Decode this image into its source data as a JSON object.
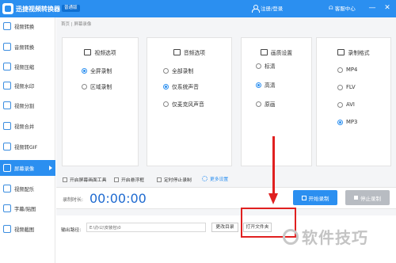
{
  "app": {
    "title": "迅捷视频转换器",
    "badge": "普通版"
  },
  "header": {
    "user_label": "注册/登录",
    "support_label": "客服中心",
    "minimize": "—",
    "close": "✕"
  },
  "sidebar": {
    "items": [
      {
        "label": "视频转换",
        "icon": "video-convert-icon"
      },
      {
        "label": "音频转换",
        "icon": "audio-convert-icon"
      },
      {
        "label": "视频压缩",
        "icon": "compress-icon"
      },
      {
        "label": "视频水印",
        "icon": "watermark-icon"
      },
      {
        "label": "视频分割",
        "icon": "split-icon"
      },
      {
        "label": "视频合并",
        "icon": "merge-icon"
      },
      {
        "label": "视频转GIF",
        "icon": "gif-icon"
      },
      {
        "label": "屏幕录像",
        "icon": "record-icon",
        "active": true
      },
      {
        "label": "视频配乐",
        "icon": "music-icon"
      },
      {
        "label": "字幕/贴图",
        "icon": "subtitle-icon"
      },
      {
        "label": "视频截图",
        "icon": "screenshot-icon"
      }
    ]
  },
  "breadcrumb": {
    "home": "首页",
    "sep": "|",
    "current": "屏幕录像"
  },
  "panels": {
    "video": {
      "title": "视频选项",
      "options": [
        "全屏录制",
        "区域录制"
      ],
      "selected": 0
    },
    "audio": {
      "title": "音频选项",
      "options": [
        "全部录制",
        "仅系统声音",
        "仅麦克风声音"
      ],
      "selected": 1
    },
    "quality": {
      "title": "画质设置",
      "options": [
        "标清",
        "高清",
        "原画"
      ],
      "selected": 1
    },
    "format": {
      "title": "录制格式",
      "options": [
        "MP4",
        "FLV",
        "AVI",
        "MP3"
      ],
      "selected": 3
    }
  },
  "checkboxes": [
    "开启屏幕画面工具",
    "开启悬浮框",
    "定时停止录制"
  ],
  "more_settings": "更多设置",
  "record": {
    "duration_label": "录制时长:",
    "timer": "00:00:00",
    "start_label": "开始录制",
    "stop_label": "停止录制"
  },
  "output": {
    "label": "输出路径:",
    "path": "E:\\办公\\安装包\\0",
    "change_label": "更改目录",
    "open_label": "打开文件夹"
  },
  "watermark": {
    "text": "软件技巧"
  },
  "colors": {
    "accent": "#2b8ff0",
    "annotation": "#e02020",
    "timer": "#1e6ad0"
  }
}
